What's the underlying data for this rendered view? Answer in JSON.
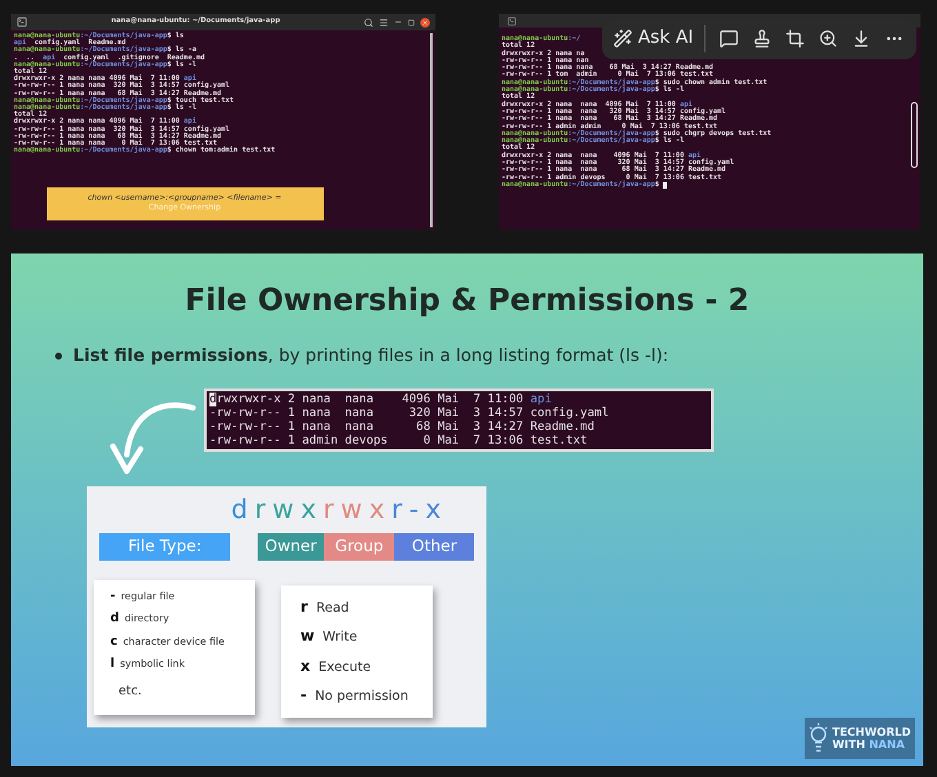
{
  "terminals": [
    {
      "title": "nana@nana-ubuntu: ~/Documents/java-app",
      "lines": [
        [
          {
            "kind": "prompt",
            "t": "nana@nana-ubuntu"
          },
          {
            "kind": "path",
            "t": ":~/Documents/java-app"
          },
          {
            "kind": "text",
            "t": "$ ls"
          }
        ],
        [
          {
            "kind": "dir",
            "t": "api"
          },
          {
            "kind": "text",
            "t": "  config.yaml  Readme.md"
          }
        ],
        [
          {
            "kind": "prompt",
            "t": "nana@nana-ubuntu"
          },
          {
            "kind": "path",
            "t": ":~/Documents/java-app"
          },
          {
            "kind": "text",
            "t": "$ ls -a"
          }
        ],
        [
          {
            "kind": "text",
            "t": ".  ..  "
          },
          {
            "kind": "dir",
            "t": "api"
          },
          {
            "kind": "text",
            "t": "  config.yaml  .gitignore  Readme.md"
          }
        ],
        [
          {
            "kind": "prompt",
            "t": "nana@nana-ubuntu"
          },
          {
            "kind": "path",
            "t": ":~/Documents/java-app"
          },
          {
            "kind": "text",
            "t": "$ ls -l"
          }
        ],
        [
          {
            "kind": "text",
            "t": "total 12"
          }
        ],
        [
          {
            "kind": "text",
            "t": "drwxrwxr-x 2 nana nana 4096 Mai  7 11:00 "
          },
          {
            "kind": "dir",
            "t": "api"
          }
        ],
        [
          {
            "kind": "text",
            "t": "-rw-rw-r-- 1 nana nana  320 Mai  3 14:57 config.yaml"
          }
        ],
        [
          {
            "kind": "text",
            "t": "-rw-rw-r-- 1 nana nana   68 Mai  3 14:27 Readme.md"
          }
        ],
        [
          {
            "kind": "prompt",
            "t": "nana@nana-ubuntu"
          },
          {
            "kind": "path",
            "t": ":~/Documents/java-app"
          },
          {
            "kind": "text",
            "t": "$ touch test.txt"
          }
        ],
        [
          {
            "kind": "prompt",
            "t": "nana@nana-ubuntu"
          },
          {
            "kind": "path",
            "t": ":~/Documents/java-app"
          },
          {
            "kind": "text",
            "t": "$ ls -l"
          }
        ],
        [
          {
            "kind": "text",
            "t": "total 12"
          }
        ],
        [
          {
            "kind": "text",
            "t": "drwxrwxr-x 2 nana nana 4096 Mai  7 11:00 "
          },
          {
            "kind": "dir",
            "t": "api"
          }
        ],
        [
          {
            "kind": "text",
            "t": "-rw-rw-r-- 1 nana nana  320 Mai  3 14:57 config.yaml"
          }
        ],
        [
          {
            "kind": "text",
            "t": "-rw-rw-r-- 1 nana nana   68 Mai  3 14:27 Readme.md"
          }
        ],
        [
          {
            "kind": "text",
            "t": "-rw-rw-r-- 1 nana nana    0 Mai  7 13:06 test.txt"
          }
        ],
        [
          {
            "kind": "prompt",
            "t": "nana@nana-ubuntu"
          },
          {
            "kind": "path",
            "t": ":~/Documents/java-app"
          },
          {
            "kind": "text",
            "t": "$ chown tom:admin test.txt"
          }
        ]
      ],
      "caption": {
        "command": "chown <username>:<groupname> <filename> =",
        "meaning": "Change Ownership"
      }
    },
    {
      "lines": [
        [
          {
            "kind": "prompt",
            "t": "nana@nana-ubuntu"
          },
          {
            "kind": "path",
            "t": ":~/"
          }
        ],
        [
          {
            "kind": "text",
            "t": "total 12"
          }
        ],
        [
          {
            "kind": "text",
            "t": "drwxrwxr-x 2 nana na"
          }
        ],
        [
          {
            "kind": "text",
            "t": "-rw-rw-r-- 1 nana nan"
          }
        ],
        [
          {
            "kind": "text",
            "t": "-rw-rw-r-- 1 nana nana    68 Mai  3 14:27 Readme.md"
          }
        ],
        [
          {
            "kind": "text",
            "t": "-rw-rw-r-- 1 tom  admin     0 Mai  7 13:06 test.txt"
          }
        ],
        [
          {
            "kind": "prompt",
            "t": "nana@nana-ubuntu"
          },
          {
            "kind": "path",
            "t": ":~/Documents/java-app"
          },
          {
            "kind": "text",
            "t": "$ sudo chown admin test.txt"
          }
        ],
        [
          {
            "kind": "prompt",
            "t": "nana@nana-ubuntu"
          },
          {
            "kind": "path",
            "t": ":~/Documents/java-app"
          },
          {
            "kind": "text",
            "t": "$ ls -l"
          }
        ],
        [
          {
            "kind": "text",
            "t": "total 12"
          }
        ],
        [
          {
            "kind": "text",
            "t": "drwxrwxr-x 2 nana  nana  4096 Mai  7 11:00 "
          },
          {
            "kind": "dir",
            "t": "api"
          }
        ],
        [
          {
            "kind": "text",
            "t": "-rw-rw-r-- 1 nana  nana   320 Mai  3 14:57 config.yaml"
          }
        ],
        [
          {
            "kind": "text",
            "t": "-rw-rw-r-- 1 nana  nana    68 Mai  3 14:27 Readme.md"
          }
        ],
        [
          {
            "kind": "text",
            "t": "-rw-rw-r-- 1 admin admin     0 Mai  7 13:06 test.txt"
          }
        ],
        [
          {
            "kind": "prompt",
            "t": "nana@nana-ubuntu"
          },
          {
            "kind": "path",
            "t": ":~/Documents/java-app"
          },
          {
            "kind": "text",
            "t": "$ sudo chgrp devops test.txt"
          }
        ],
        [
          {
            "kind": "prompt",
            "t": "nana@nana-ubuntu"
          },
          {
            "kind": "path",
            "t": ":~/Documents/java-app"
          },
          {
            "kind": "text",
            "t": "$ ls -l"
          }
        ],
        [
          {
            "kind": "text",
            "t": "total 12"
          }
        ],
        [
          {
            "kind": "text",
            "t": "drwxrwxr-x 2 nana  nana    4096 Mai  7 11:00 "
          },
          {
            "kind": "dir",
            "t": "api"
          }
        ],
        [
          {
            "kind": "text",
            "t": "-rw-rw-r-- 1 nana  nana     320 Mai  3 14:57 config.yaml"
          }
        ],
        [
          {
            "kind": "text",
            "t": "-rw-rw-r-- 1 nana  nana      68 Mai  3 14:27 Readme.md"
          }
        ],
        [
          {
            "kind": "text",
            "t": "-rw-rw-r-- 1 admin devops     0 Mai  7 13:06 test.txt"
          }
        ],
        [
          {
            "kind": "prompt",
            "t": "nana@nana-ubuntu"
          },
          {
            "kind": "path",
            "t": ":~/Documents/java-app"
          },
          {
            "kind": "text",
            "t": "$ "
          }
        ]
      ],
      "cursor_visible": true,
      "toolbar": {
        "ask_ai": "Ask AI"
      }
    }
  ],
  "slide": {
    "title": "File Ownership & Permissions - 2",
    "bullet": "**List file permissions**, by printing files in a long listing format (ls -l):",
    "listing": [
      [
        {
          "kind": "cursor",
          "t": "d"
        },
        {
          "kind": "text",
          "t": "rwxrwxr-x 2 nana  nana    4096 Mai  7 11:00 "
        },
        {
          "kind": "dir",
          "t": "api"
        }
      ],
      [
        {
          "kind": "text",
          "t": "-rw-rw-r-- 1 nana  nana     320 Mai  3 14:57 config.yaml"
        }
      ],
      [
        {
          "kind": "text",
          "t": "-rw-rw-r-- 1 nana  nana      68 Mai  3 14:27 Readme.md"
        }
      ],
      [
        {
          "kind": "text",
          "t": "-rw-rw-r-- 1 admin devops     0 Mai  7 13:06 test.txt"
        }
      ]
    ],
    "permission_string": [
      {
        "char": "d",
        "kind": "type"
      },
      {
        "char": "r",
        "kind": "owner"
      },
      {
        "char": "w",
        "kind": "owner"
      },
      {
        "char": "x",
        "kind": "owner"
      },
      {
        "char": "r",
        "kind": "group"
      },
      {
        "char": "w",
        "kind": "group"
      },
      {
        "char": "x",
        "kind": "group"
      },
      {
        "char": "r",
        "kind": "other"
      },
      {
        "char": "-",
        "kind": "other"
      },
      {
        "char": "x",
        "kind": "other"
      }
    ],
    "headers": [
      {
        "label": "File Type:",
        "kind": "type"
      },
      {
        "label": "Owner",
        "kind": "owner"
      },
      {
        "label": "Group",
        "kind": "group"
      },
      {
        "label": "Other",
        "kind": "other"
      }
    ],
    "file_types": [
      {
        "symbol": "-",
        "label": "regular file"
      },
      {
        "symbol": "d",
        "label": "directory"
      },
      {
        "symbol": "c",
        "label": "character device file"
      },
      {
        "symbol": "l",
        "label": "symbolic link"
      }
    ],
    "file_types_note": "etc.",
    "permissions": [
      {
        "symbol": "r",
        "label": "Read"
      },
      {
        "symbol": "w",
        "label": "Write"
      },
      {
        "symbol": "x",
        "label": "Execute"
      },
      {
        "symbol": "-",
        "label": "No permission"
      }
    ],
    "logo": {
      "line1": "TECHWORLD",
      "line2": "WITH",
      "line2_accent": "NANA"
    }
  }
}
